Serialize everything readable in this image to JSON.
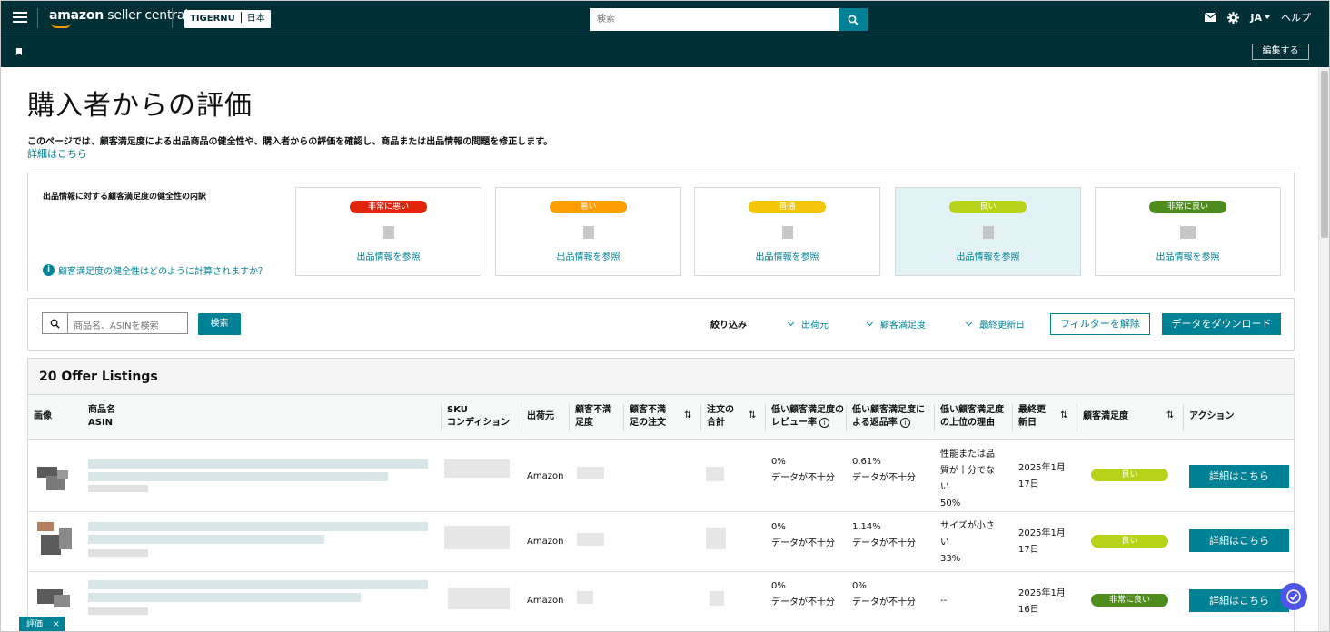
{
  "topbar": {
    "logo_brand": "amazon",
    "logo_rest": " seller central",
    "store_name": "TIGERNU",
    "store_region": "日本",
    "search_placeholder": "検索",
    "language": "JA",
    "help": "ヘルプ"
  },
  "subbar": {
    "edit_label": "編集する"
  },
  "page": {
    "title": "購入者からの評価",
    "description": "このページでは、顧客満足度による出品商品の健全性や、購入者からの評価を確認し、商品または出品情報の問題を修正します。",
    "learn_more": "詳細はこちら"
  },
  "health": {
    "title": "出品情報に対する顧客満足度の健全性の内訳",
    "help_link": "顧客満足度の健全性はどのように計算されますか？",
    "cards": [
      {
        "badge": "非常に悪い",
        "color": "#e0250b",
        "link": "出品情報を参照"
      },
      {
        "badge": "悪い",
        "color": "#ff9b05",
        "link": "出品情報を参照"
      },
      {
        "badge": "普通",
        "color": "#f4c508",
        "link": "出品情報を参照"
      },
      {
        "badge": "良い",
        "color": "#b6d319",
        "link": "出品情報を参照"
      },
      {
        "badge": "非常に良い",
        "color": "#4e8d1c",
        "link": "出品情報を参照"
      }
    ]
  },
  "filters": {
    "search_placeholder": "商品名、ASINを検索",
    "search_button": "検索",
    "label": "絞り込み",
    "dropdowns": [
      "出荷元",
      "顧客満足度",
      "最終更新日"
    ],
    "clear_button": "フィルターを解除",
    "download_button": "データをダウンロード"
  },
  "table": {
    "title": "20 Offer Listings",
    "headers": {
      "image": "画像",
      "product_name": "商品名",
      "asin": "ASIN",
      "sku": "SKU",
      "condition": "コンディション",
      "ship_from": "出荷元",
      "dissatisfaction_rate_1": "顧客不満",
      "dissatisfaction_rate_2": "足度",
      "dissatisfied_orders_1": "顧客不満",
      "dissatisfied_orders_2": "足の注文",
      "total_orders_1": "注文の",
      "total_orders_2": "合計",
      "low_review_1": "低い顧客満足度の",
      "low_review_2": "レビュー率",
      "low_return_1": "低い顧客満足度に",
      "low_return_2": "よる返品率",
      "top_reason_1": "低い顧客満足度",
      "top_reason_2": "の上位の理由",
      "last_updated_1": "最終更",
      "last_updated_2": "新日",
      "satisfaction": "顧客満足度",
      "action": "アクション"
    },
    "rows": [
      {
        "ship_from": "Amazon",
        "review_rate": "0%",
        "review_note": "データが不十分",
        "return_rate": "0.61%",
        "return_note": "データが不十分",
        "reason_lines": [
          "性能または品",
          "質が十分でな",
          "い",
          "50%"
        ],
        "date_1": "2025年1月",
        "date_2": "17日",
        "badge": "良い",
        "badge_color": "#b6d319",
        "action": "詳細はこちら"
      },
      {
        "ship_from": "Amazon",
        "review_rate": "0%",
        "review_note": "データが不十分",
        "return_rate": "1.14%",
        "return_note": "データが不十分",
        "reason_lines": [
          "サイズが小さ",
          "い",
          "33%"
        ],
        "date_1": "2025年1月",
        "date_2": "17日",
        "badge": "良い",
        "badge_color": "#b6d319",
        "action": "詳細はこちら"
      },
      {
        "ship_from": "Amazon",
        "review_rate": "0%",
        "review_note": "データが不十分",
        "return_rate": "0%",
        "return_note": "データが不十分",
        "reason_lines": [
          "--"
        ],
        "date_1": "2025年1月",
        "date_2": "16日",
        "badge": "非常に良い",
        "badge_color": "#4e8d1c",
        "action": "詳細はこちら"
      }
    ]
  },
  "bottom_tab": {
    "label": "評価",
    "close": "×"
  }
}
